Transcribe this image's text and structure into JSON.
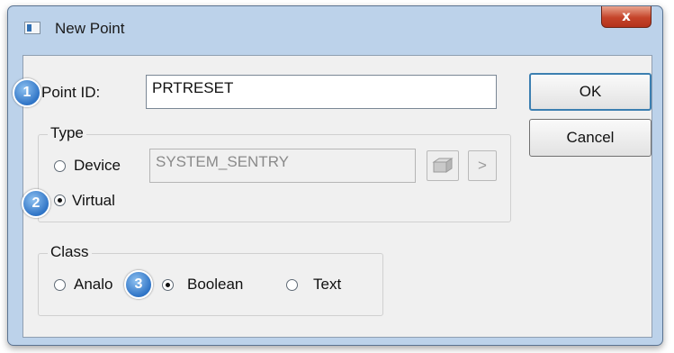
{
  "window": {
    "title": "New Point",
    "close_glyph": "x"
  },
  "point_id": {
    "label": "Point ID:",
    "value": "PRTRESET",
    "badge": "1"
  },
  "type_group": {
    "title": "Type",
    "device_label": "Device",
    "device_value": "SYSTEM_SENTRY",
    "browse_icon": "browse-icon",
    "arrow_glyph": ">",
    "virtual_label": "Virtual",
    "selected": "Virtual",
    "badge": "2"
  },
  "class_group": {
    "title": "Class",
    "analog_label": "Analo",
    "boolean_label": "Boolean",
    "text_label": "Text",
    "selected": "Boolean",
    "badge": "3"
  },
  "buttons": {
    "ok": "OK",
    "cancel": "Cancel"
  },
  "colors": {
    "accent": "#3c7fb1",
    "badge": "#2f74c6",
    "close": "#c5442a"
  }
}
